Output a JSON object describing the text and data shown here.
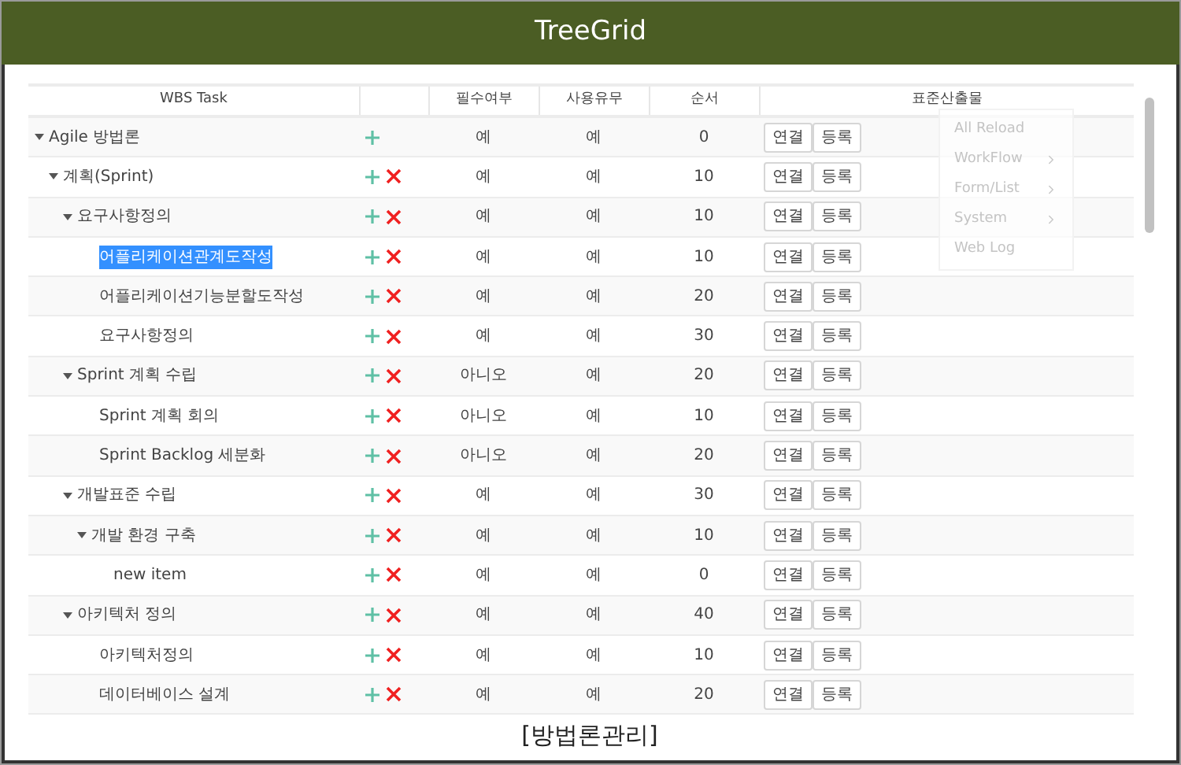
{
  "window": {
    "title": "TreeGrid"
  },
  "table": {
    "columns": [
      "WBS Task",
      "",
      "필수여부",
      "사용유무",
      "순서",
      "표준산출물"
    ],
    "rows": [
      {
        "task": "Agile 방법론",
        "expanded": true,
        "removable": false,
        "selected": false,
        "required": "예",
        "used": "예",
        "order": "0",
        "actions": [
          "연결",
          "등록"
        ],
        "children": [
          {
            "task": "계획(Sprint)",
            "expanded": true,
            "removable": true,
            "selected": false,
            "required": "예",
            "used": "예",
            "order": "10",
            "actions": [
              "연결",
              "등록"
            ],
            "children": [
              {
                "task": "요구사항정의",
                "expanded": true,
                "removable": true,
                "selected": false,
                "required": "예",
                "used": "예",
                "order": "10",
                "actions": [
                  "연결",
                  "등록"
                ],
                "children": [
                  {
                    "task": "어플리케이션관계도작성",
                    "removable": true,
                    "selected": true,
                    "required": "예",
                    "used": "예",
                    "order": "10",
                    "actions": [
                      "연결",
                      "등록"
                    ]
                  },
                  {
                    "task": "어플리케이션기능분할도작성",
                    "removable": true,
                    "selected": false,
                    "required": "예",
                    "used": "예",
                    "order": "20",
                    "actions": [
                      "연결",
                      "등록"
                    ]
                  },
                  {
                    "task": "요구사항정의",
                    "removable": true,
                    "selected": false,
                    "required": "예",
                    "used": "예",
                    "order": "30",
                    "actions": [
                      "연결",
                      "등록"
                    ]
                  }
                ]
              },
              {
                "task": "Sprint 계획 수립",
                "expanded": true,
                "removable": true,
                "selected": false,
                "required": "아니오",
                "used": "예",
                "order": "20",
                "actions": [
                  "연결",
                  "등록"
                ],
                "children": [
                  {
                    "task": "Sprint 계획 회의",
                    "removable": true,
                    "selected": false,
                    "required": "아니오",
                    "used": "예",
                    "order": "10",
                    "actions": [
                      "연결",
                      "등록"
                    ]
                  },
                  {
                    "task": "Sprint Backlog 세분화",
                    "removable": true,
                    "selected": false,
                    "required": "아니오",
                    "used": "예",
                    "order": "20",
                    "actions": [
                      "연결",
                      "등록"
                    ]
                  }
                ]
              },
              {
                "task": "개발표준 수립",
                "expanded": true,
                "removable": true,
                "selected": false,
                "required": "예",
                "used": "예",
                "order": "30",
                "actions": [
                  "연결",
                  "등록"
                ],
                "children": [
                  {
                    "task": "개발 환경 구축",
                    "expanded": true,
                    "removable": true,
                    "selected": false,
                    "required": "예",
                    "used": "예",
                    "order": "10",
                    "actions": [
                      "연결",
                      "등록"
                    ],
                    "children": [
                      {
                        "task": "new item",
                        "removable": true,
                        "selected": false,
                        "required": "예",
                        "used": "예",
                        "order": "0",
                        "actions": [
                          "연결",
                          "등록"
                        ]
                      }
                    ]
                  }
                ]
              },
              {
                "task": "아키텍처 정의",
                "expanded": true,
                "removable": true,
                "selected": false,
                "required": "예",
                "used": "예",
                "order": "40",
                "actions": [
                  "연결",
                  "등록"
                ],
                "children": [
                  {
                    "task": "아키텍처정의",
                    "removable": true,
                    "selected": false,
                    "required": "예",
                    "used": "예",
                    "order": "10",
                    "actions": [
                      "연결",
                      "등록"
                    ]
                  },
                  {
                    "task": "데이터베이스 설계",
                    "removable": true,
                    "selected": false,
                    "required": "예",
                    "used": "예",
                    "order": "20",
                    "actions": [
                      "연결",
                      "등록"
                    ]
                  }
                ]
              }
            ]
          }
        ]
      }
    ]
  },
  "overlay_menu": {
    "items": [
      {
        "label": "All Reload",
        "submenu": false
      },
      {
        "label": "WorkFlow",
        "submenu": true
      },
      {
        "label": "Form/List",
        "submenu": true
      },
      {
        "label": "System",
        "submenu": true
      },
      {
        "label": "Web Log",
        "submenu": false
      }
    ]
  },
  "footer": "[방법론관리]"
}
